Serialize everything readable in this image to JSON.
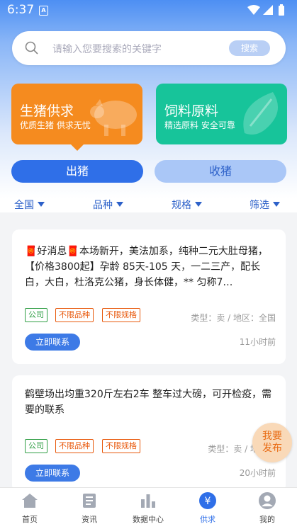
{
  "status": {
    "time": "6:37",
    "sim": "A"
  },
  "search": {
    "placeholder": "请输入您要搜索的关键字",
    "button": "搜索"
  },
  "cards": [
    {
      "title": "生猪供求",
      "subtitle": "优质生猪 供求无忧",
      "color": "#f58b1f"
    },
    {
      "title": "饲料原料",
      "subtitle": "精选原料 安全可靠",
      "color": "#17c49a"
    }
  ],
  "toggle": {
    "sell": "出猪",
    "buy": "收猪"
  },
  "filters": [
    "全国",
    "品种",
    "规格",
    "筛选"
  ],
  "posts": [
    {
      "text": "🧧好消息🧧本场新开，美法加系，纯种二元大肚母猪，【价格3800起】孕龄 85天-105 天，一二三产，配长白，大白，杜洛克公猪，身长体健，** 匀称7…",
      "tags": [
        "公司",
        "不限品种",
        "不限规格"
      ],
      "meta": "类型：卖 / 地区：全国",
      "button": "立即联系",
      "time": "11小时前"
    },
    {
      "text": "鹤壁场出均重320斤左右2车 整车过大磅，可开检疫，需要的联系",
      "tags": [
        "公司",
        "不限品种",
        "不限规格"
      ],
      "meta": "类型：卖 / 地区：",
      "button": "立即联系",
      "time": "20小时前"
    }
  ],
  "fab": {
    "line1": "我要",
    "line2": "发布"
  },
  "nav": [
    {
      "label": "首页",
      "icon": "home-icon"
    },
    {
      "label": "资讯",
      "icon": "news-icon"
    },
    {
      "label": "数据中心",
      "icon": "chart-icon"
    },
    {
      "label": "供求",
      "icon": "yuan-icon"
    },
    {
      "label": "我的",
      "icon": "user-icon"
    }
  ],
  "colors": {
    "primary": "#2f6fe8",
    "orange": "#f58b1f",
    "green": "#17c49a"
  }
}
